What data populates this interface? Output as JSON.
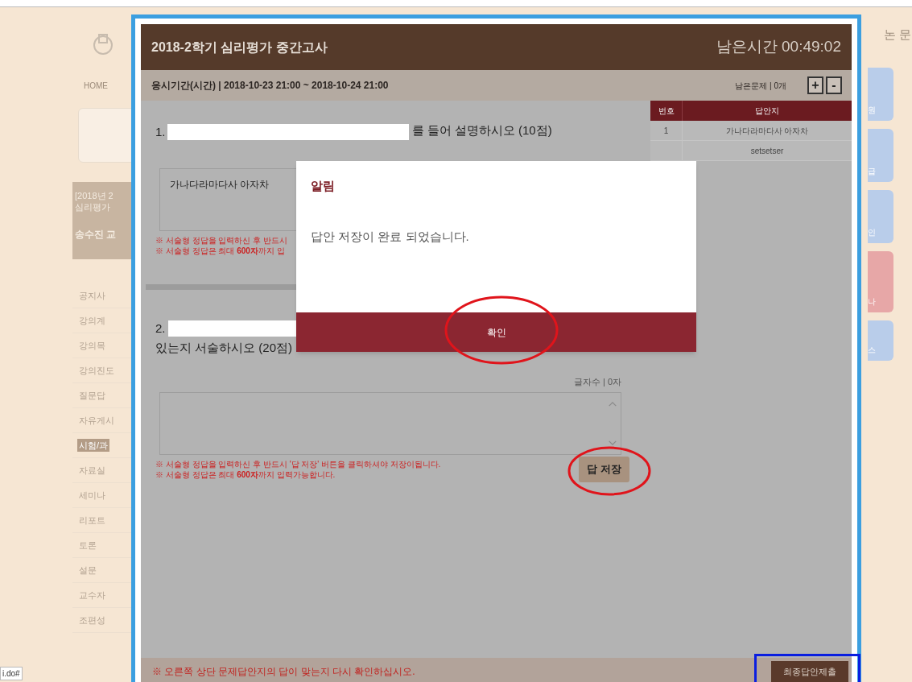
{
  "browser_status": "i.do#",
  "top_right_link": "논 문",
  "sidebar": {
    "home": "HOME",
    "course_lines": [
      "[2018년 2",
      "심리평가"
    ],
    "professor": "송수진 교",
    "menu": [
      {
        "label": "공지사",
        "selected": false
      },
      {
        "label": "강의계",
        "selected": false
      },
      {
        "label": "강의목",
        "selected": false
      },
      {
        "label": "강의진도",
        "selected": false
      },
      {
        "label": "질문답",
        "selected": false
      },
      {
        "label": "자유게시",
        "selected": false
      },
      {
        "label": "시험/과",
        "selected": true
      },
      {
        "label": "자료실",
        "selected": false
      },
      {
        "label": "세미나",
        "selected": false
      },
      {
        "label": "리포트",
        "selected": false
      },
      {
        "label": "토론",
        "selected": false
      },
      {
        "label": "설문",
        "selected": false
      },
      {
        "label": "교수자",
        "selected": false
      },
      {
        "label": "조편성",
        "selected": false
      }
    ]
  },
  "right_cards": [
    {
      "text": "원",
      "color": "#b9cdea"
    },
    {
      "text": "급",
      "color": "#b9cdea"
    },
    {
      "text": "인",
      "color": "#b9cdea"
    },
    {
      "text": "나",
      "color": "#e7a7a7"
    },
    {
      "text": "스",
      "color": "#b9cdea"
    }
  ],
  "exam": {
    "title": "2018-2학기 심리평가 중간고사",
    "timer": "남은시간 00:49:02",
    "period": "응시기간(시간) | 2018-10-23 21:00 ~ 2018-10-24 21:00",
    "remaining": "남은문제 | 0개",
    "zoom_buttons": [
      "+",
      "-"
    ],
    "questions": [
      {
        "number": "1.",
        "lines": [
          "를 들어 설명하시오 (10점)"
        ],
        "answer": "가나다라마다사 아자차",
        "notes": [
          "※ 서술형 정답을 입력하신 후 반드시",
          "※ 서술형 정답은 최대 **600자**까지 입"
        ]
      },
      {
        "number": "2.",
        "lines": [
          "있는지 서술하시오 (20점)"
        ],
        "char_count": "글자수 | 0자",
        "notes": [
          "※ 서술형 정답을 입력하신 후 반드시 '답 저장' 버튼을 클릭하셔야 저장이됩니다.",
          "※ 서술형 정답은 최대 **600자**까지 입력가능합니다."
        ],
        "save_button": "답 저장"
      }
    ],
    "answer_sheet": {
      "columns": [
        "번호",
        "답안지"
      ],
      "rows": [
        {
          "no": "1",
          "answer": "가나다라마다사 아자차"
        },
        {
          "answer": "setsetser"
        }
      ]
    },
    "footer_note": "※ 오른쪽 상단 문제답안지의 답이 맞는지 다시 확인하십시오.",
    "submit_button": "최종답안제출"
  },
  "dialog": {
    "title": "알림",
    "message": "답안 저장이 완료 되었습니다.",
    "button": "확인"
  }
}
